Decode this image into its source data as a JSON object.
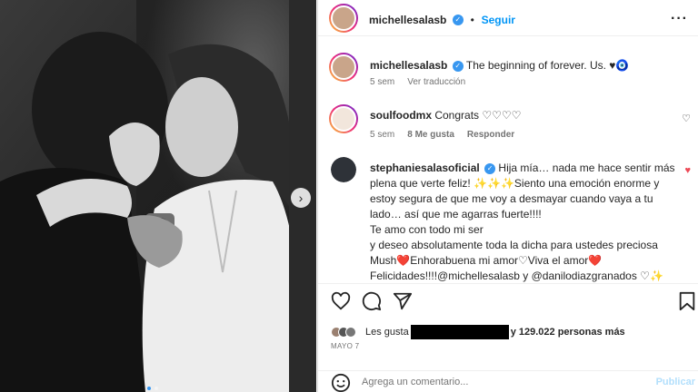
{
  "post": {
    "author": "michellesalasb",
    "follow_label": "Seguir",
    "more_label": "···"
  },
  "caption": {
    "author": "michellesalasb",
    "text": "The beginning of forever. Us. ♥🧿",
    "age": "5 sem",
    "translate_label": "Ver traducción"
  },
  "comments": [
    {
      "author": "soulfoodmx",
      "text": "Congrats ♡♡♡♡",
      "age": "5 sem",
      "likes": "8 Me gusta",
      "reply_label": "Responder"
    },
    {
      "author": "stephaniesalasoficial",
      "lines": [
        "Hija mía… nada me hace sentir más",
        "plena que verte feliz! ✨✨✨Siento una emoción enorme y",
        "estoy segura de que me voy a desmayar cuando vaya a tu",
        "lado… así que me agarras fuerte!!!!",
        "Te amo con todo mi ser",
        "y deseo absolutamente toda la dicha para ustedes preciosa",
        "Mush❤️Enhorabuena mi amor♡Viva el amor❤️",
        "Felicidades!!!!@michellesalasb y @danilodiazgranados ♡✨"
      ]
    }
  ],
  "likes": {
    "prefix": "Les gusta",
    "suffix": "y 129.022 personas más"
  },
  "date": "MAYO 7",
  "comment_box": {
    "placeholder": "Agrega un comentario...",
    "post_label": "Publicar"
  },
  "colors": {
    "accent": "#0095f6",
    "verified": "#3897f0",
    "heart": "#ed4956"
  },
  "icons": [
    "heart-icon",
    "comment-icon",
    "share-icon",
    "bookmark-icon",
    "emoji-icon",
    "chevron-right-icon"
  ]
}
